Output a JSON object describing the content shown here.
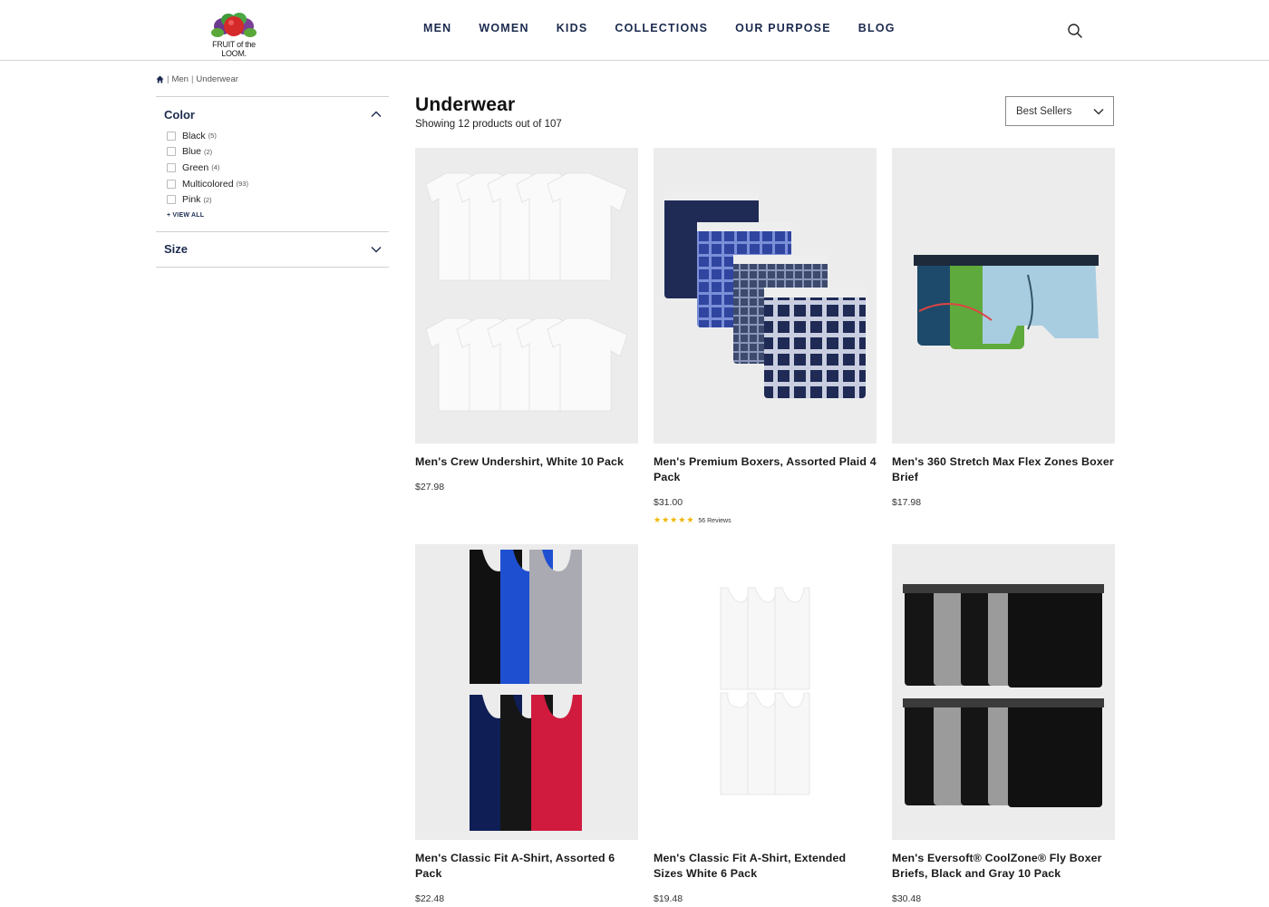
{
  "brand": {
    "name": "FRUIT of the LOOM."
  },
  "nav": {
    "items": [
      "MEN",
      "WOMEN",
      "KIDS",
      "COLLECTIONS",
      "OUR PURPOSE",
      "BLOG"
    ]
  },
  "breadcrumb": {
    "items": [
      "Men",
      "Underwear"
    ]
  },
  "filters": {
    "color": {
      "title": "Color",
      "options": [
        {
          "label": "Black",
          "count": "(5)"
        },
        {
          "label": "Blue",
          "count": "(2)"
        },
        {
          "label": "Green",
          "count": "(4)"
        },
        {
          "label": "Multicolored",
          "count": "(93)"
        },
        {
          "label": "Pink",
          "count": "(2)"
        }
      ],
      "view_all": "+ VIEW ALL"
    },
    "size": {
      "title": "Size"
    }
  },
  "listing": {
    "title": "Underwear",
    "showing": "Showing 12 products out of 107",
    "sort": "Best Sellers"
  },
  "products": [
    {
      "name": "Men's Crew Undershirt, White 10 Pack",
      "price": "$27.98"
    },
    {
      "name": "Men's Premium Boxers, Assorted Plaid 4 Pack",
      "price": "$31.00",
      "rating": 4.5,
      "reviews": "56 Reviews"
    },
    {
      "name": "Men's 360 Stretch Max Flex Zones Boxer Brief",
      "price": "$17.98"
    },
    {
      "name": "Men's Classic Fit A-Shirt, Assorted 6 Pack",
      "price": "$22.48"
    },
    {
      "name": "Men's Classic Fit A-Shirt, Extended Sizes White 6 Pack",
      "price": "$19.48"
    },
    {
      "name": "Men's Eversoft® CoolZone® Fly Boxer Briefs, Black and Gray 10 Pack",
      "price": "$30.48"
    }
  ],
  "colors": {
    "navy": "#1b2a4e",
    "star": "#f0b400",
    "image_bg": "#ececec"
  }
}
